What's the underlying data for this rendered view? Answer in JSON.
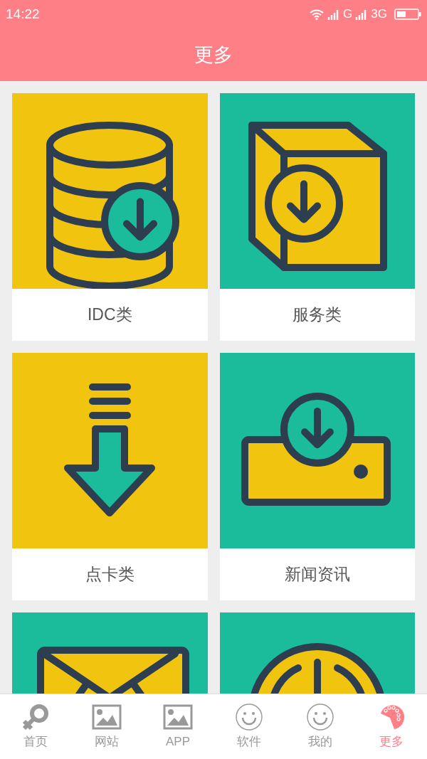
{
  "status_bar": {
    "time": "14:22",
    "network_1": "G",
    "network_2": "3G"
  },
  "header": {
    "title": "更多"
  },
  "cards": [
    {
      "kind": "database",
      "color": "#f1c40f",
      "label": "IDC类"
    },
    {
      "kind": "box",
      "color": "#1abc9c",
      "label": "服务类"
    },
    {
      "kind": "arrow",
      "color": "#f1c40f",
      "label": "点卡类"
    },
    {
      "kind": "drive",
      "color": "#1abc9c",
      "label": "新闻资讯"
    },
    {
      "kind": "envelope",
      "color": "#1abc9c"
    },
    {
      "kind": "power",
      "color": "#1abc9c"
    }
  ],
  "bottom_nav": [
    {
      "kind": "female",
      "label": "首页",
      "selected": false
    },
    {
      "kind": "image",
      "label": "网站",
      "selected": false
    },
    {
      "kind": "image",
      "label": "APP",
      "selected": false
    },
    {
      "kind": "smiley",
      "label": "软件",
      "selected": false
    },
    {
      "kind": "smiley",
      "label": "我的",
      "selected": false
    },
    {
      "kind": "palette",
      "label": "更多",
      "selected": true
    }
  ]
}
